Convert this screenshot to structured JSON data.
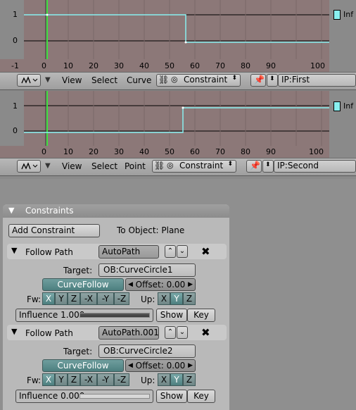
{
  "ipo_top": {
    "y_labels": [
      "1",
      "0"
    ],
    "x_ticks": [
      "-1",
      "0",
      "10",
      "20",
      "30",
      "40",
      "50",
      "60",
      "70",
      "80",
      "90",
      "100"
    ],
    "inf_label": "Inf",
    "curve_color": "#88f0f0",
    "header": {
      "menus": [
        "View",
        "Select",
        "Curve"
      ],
      "type_select": "Constraint",
      "ip_field": "IP:First"
    }
  },
  "ipo_bottom": {
    "y_labels": [
      "1",
      "0"
    ],
    "x_ticks": [
      "0",
      "10",
      "20",
      "30",
      "40",
      "50",
      "60",
      "70",
      "80",
      "90",
      "100"
    ],
    "inf_label": "Inf",
    "curve_color": "#88f0f0",
    "header": {
      "menus": [
        "View",
        "Select",
        "Point"
      ],
      "type_select": "Constraint",
      "ip_field": "IP:Second"
    }
  },
  "constraints_panel": {
    "title": "Constraints",
    "add_button": "Add Constraint",
    "to_object": "To Object: Plane",
    "constraints": [
      {
        "type": "Follow Path",
        "name": "AutoPath",
        "target_label": "Target:",
        "target": "OB:CurveCircle1",
        "curve_follow": "CurveFollow",
        "offset": "Offset: 0.00",
        "fw_label": "Fw:",
        "fw_axes": [
          "X",
          "Y",
          "Z",
          "-X",
          "-Y",
          "-Z"
        ],
        "fw_selected": 0,
        "up_label": "Up:",
        "up_axes": [
          "X",
          "Y",
          "Z"
        ],
        "up_selected": 1,
        "influence_label": "Influence 1.000",
        "influence_value": 1.0,
        "show": "Show",
        "key": "Key"
      },
      {
        "type": "Follow Path",
        "name": "AutoPath.001",
        "target_label": "Target:",
        "target": "OB:CurveCircle2",
        "curve_follow": "CurveFollow",
        "offset": "Offset: 0.00",
        "fw_label": "Fw:",
        "fw_axes": [
          "X",
          "Y",
          "Z",
          "-X",
          "-Y",
          "-Z"
        ],
        "fw_selected": 0,
        "up_label": "Up:",
        "up_axes": [
          "X",
          "Y",
          "Z"
        ],
        "up_selected": 1,
        "influence_label": "Influence 0.000",
        "influence_value": 0.0,
        "show": "Show",
        "key": "Key"
      }
    ]
  }
}
